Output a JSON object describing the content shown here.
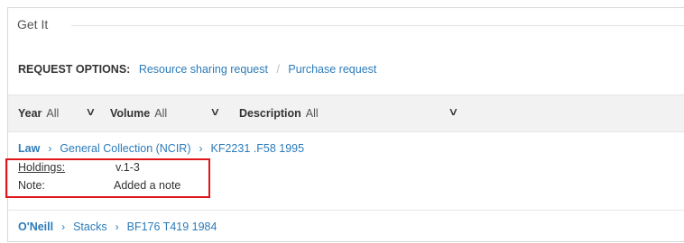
{
  "section": {
    "title": "Get It"
  },
  "request_options": {
    "label": "REQUEST OPTIONS:",
    "links": [
      "Resource sharing request",
      "Purchase request"
    ]
  },
  "filters": [
    {
      "label": "Year",
      "value": "All"
    },
    {
      "label": "Volume",
      "value": "All"
    },
    {
      "label": "Description",
      "value": "All"
    }
  ],
  "items": [
    {
      "library": "Law",
      "location": "General Collection (NCIR)",
      "call_number": "KF2231 .F58 1995",
      "holdings_label": "Holdings:",
      "holdings_value": "v.1-3",
      "note_label": "Note:",
      "note_value": "Added a note"
    },
    {
      "library": "O'Neill",
      "location": "Stacks",
      "call_number": "BF176 T419 1984"
    }
  ],
  "icons": {
    "dropdown": "chevron-down-icon",
    "breadcrumb": "chevron-right-icon"
  },
  "colors": {
    "link": "#2b7bb9",
    "highlight_box": "#e0161b",
    "filter_bar": "#f2f2f2"
  }
}
